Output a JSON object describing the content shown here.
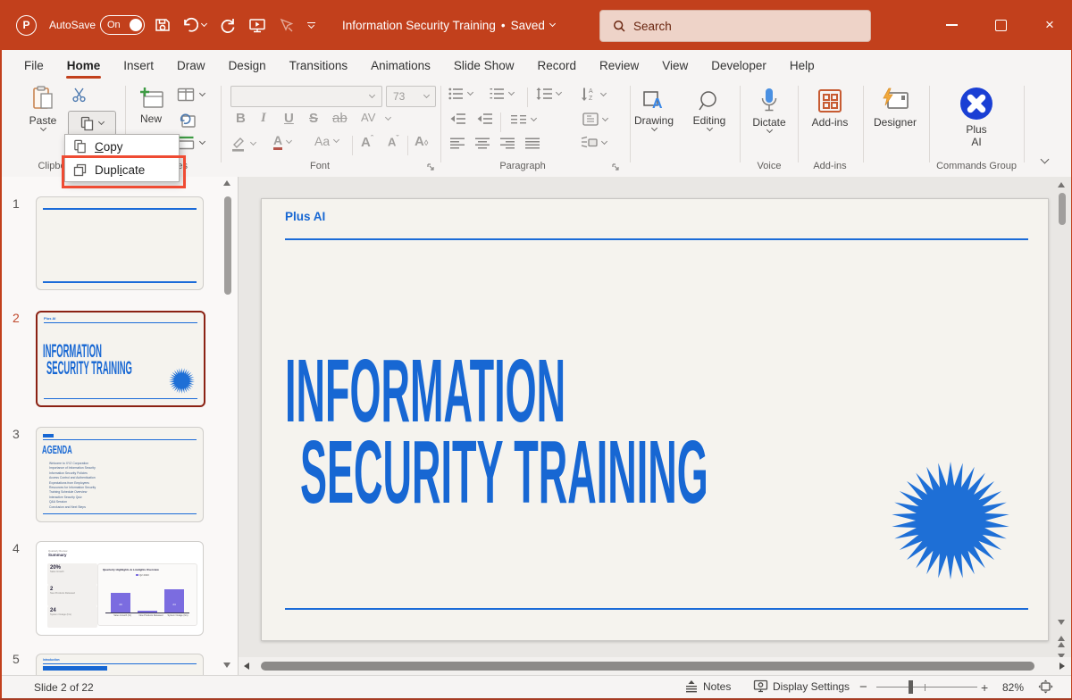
{
  "titlebar": {
    "app_letter": "P",
    "autosave_label": "AutoSave",
    "autosave_state": "On",
    "doc_title": "Information Security Training",
    "title_separator": "•",
    "save_status": "Saved",
    "search_placeholder": "Search"
  },
  "tabs": [
    {
      "label": "File"
    },
    {
      "label": "Home",
      "active": true
    },
    {
      "label": "Insert"
    },
    {
      "label": "Draw"
    },
    {
      "label": "Design"
    },
    {
      "label": "Transitions"
    },
    {
      "label": "Animations"
    },
    {
      "label": "Slide Show"
    },
    {
      "label": "Record"
    },
    {
      "label": "Review"
    },
    {
      "label": "View"
    },
    {
      "label": "Developer"
    },
    {
      "label": "Help"
    }
  ],
  "actions": {
    "record_label": "Record"
  },
  "ribbon": {
    "clipboard": {
      "paste_label": "Paste",
      "group_label": "Clipboard"
    },
    "slides_group": {
      "new_label": "New",
      "group_label": "Slides"
    },
    "context_menu": {
      "items": [
        {
          "name": "Copy",
          "pre": "",
          "accel": "C",
          "post": "opy"
        },
        {
          "name": "Duplicate",
          "pre": "Dupl",
          "accel": "i",
          "post": "cate"
        }
      ]
    },
    "font": {
      "size_value": "73",
      "group_label": "Font",
      "bold": "B",
      "italic": "I",
      "underline": "U",
      "strikethrough": "S",
      "double_strike": "ab",
      "char_spacing": "AV",
      "change_case": "Aa",
      "grow_font": "A",
      "shrink_font": "A",
      "font_color": "A",
      "clear_format": "A"
    },
    "paragraph": {
      "group_label": "Paragraph"
    },
    "drawing_label": "Drawing",
    "editing_label": "Editing",
    "voice": {
      "dictate_label": "Dictate",
      "group_label": "Voice"
    },
    "addins": {
      "label": "Add-ins",
      "group_label": "Add-ins"
    },
    "designer_label": "Designer",
    "plus_ai": {
      "line1": "Plus",
      "line2": "AI",
      "group_label": "Commands Group"
    }
  },
  "slide": {
    "header": "Plus AI",
    "title1": "INFORMATION",
    "title2": "SECURITY TRAINING"
  },
  "panel": {
    "slides": [
      {
        "num": "1"
      },
      {
        "num": "2",
        "header": "Plus AI",
        "title1": "INFORMATION",
        "title2": "SECURITY TRAINING"
      },
      {
        "num": "3",
        "title": "AGENDA",
        "items": [
          "Welcome to XYZ Corporation",
          "Importance of Information Security",
          "Information Security Policies",
          "Access Control and Authentication",
          "Expectations from Employees",
          "Resources for Information Security",
          "Training Schedule Overview",
          "Interactive Security Quiz",
          "Q&A Session",
          "Conclusion and Next Steps"
        ]
      },
      {
        "num": "4",
        "kicker": "Quarterly Review",
        "title": "Summary",
        "stats": [
          {
            "value": "20%",
            "label": "Sales Growth"
          },
          {
            "value": "2",
            "label": "New Products Released"
          },
          {
            "value": "24",
            "label": "System Outage (hrs)"
          }
        ],
        "chart": {
          "type": "bar",
          "title": "Quarterly Highlights & Lowlights Overview",
          "legend": "Q2 2023",
          "categories": [
            "Sales Growth (%)",
            "New Products Released",
            "System Outage (hrs)"
          ],
          "values": [
            20,
            2,
            24
          ]
        }
      },
      {
        "num": "5",
        "kicker": "Introduction"
      }
    ]
  },
  "statusbar": {
    "slide_indicator": "Slide 2 of 22",
    "notes_label": "Notes",
    "display_settings_label": "Display Settings",
    "zoom_out": "−",
    "zoom_in": "+",
    "zoom_level": "82%"
  },
  "colors": {
    "accent": "#c2401c",
    "slide_blue": "#1767d3",
    "annotation_red": "#ef4b33",
    "selected_thumb_border": "#8b2214",
    "chart_purple": "#7b6ce0"
  }
}
